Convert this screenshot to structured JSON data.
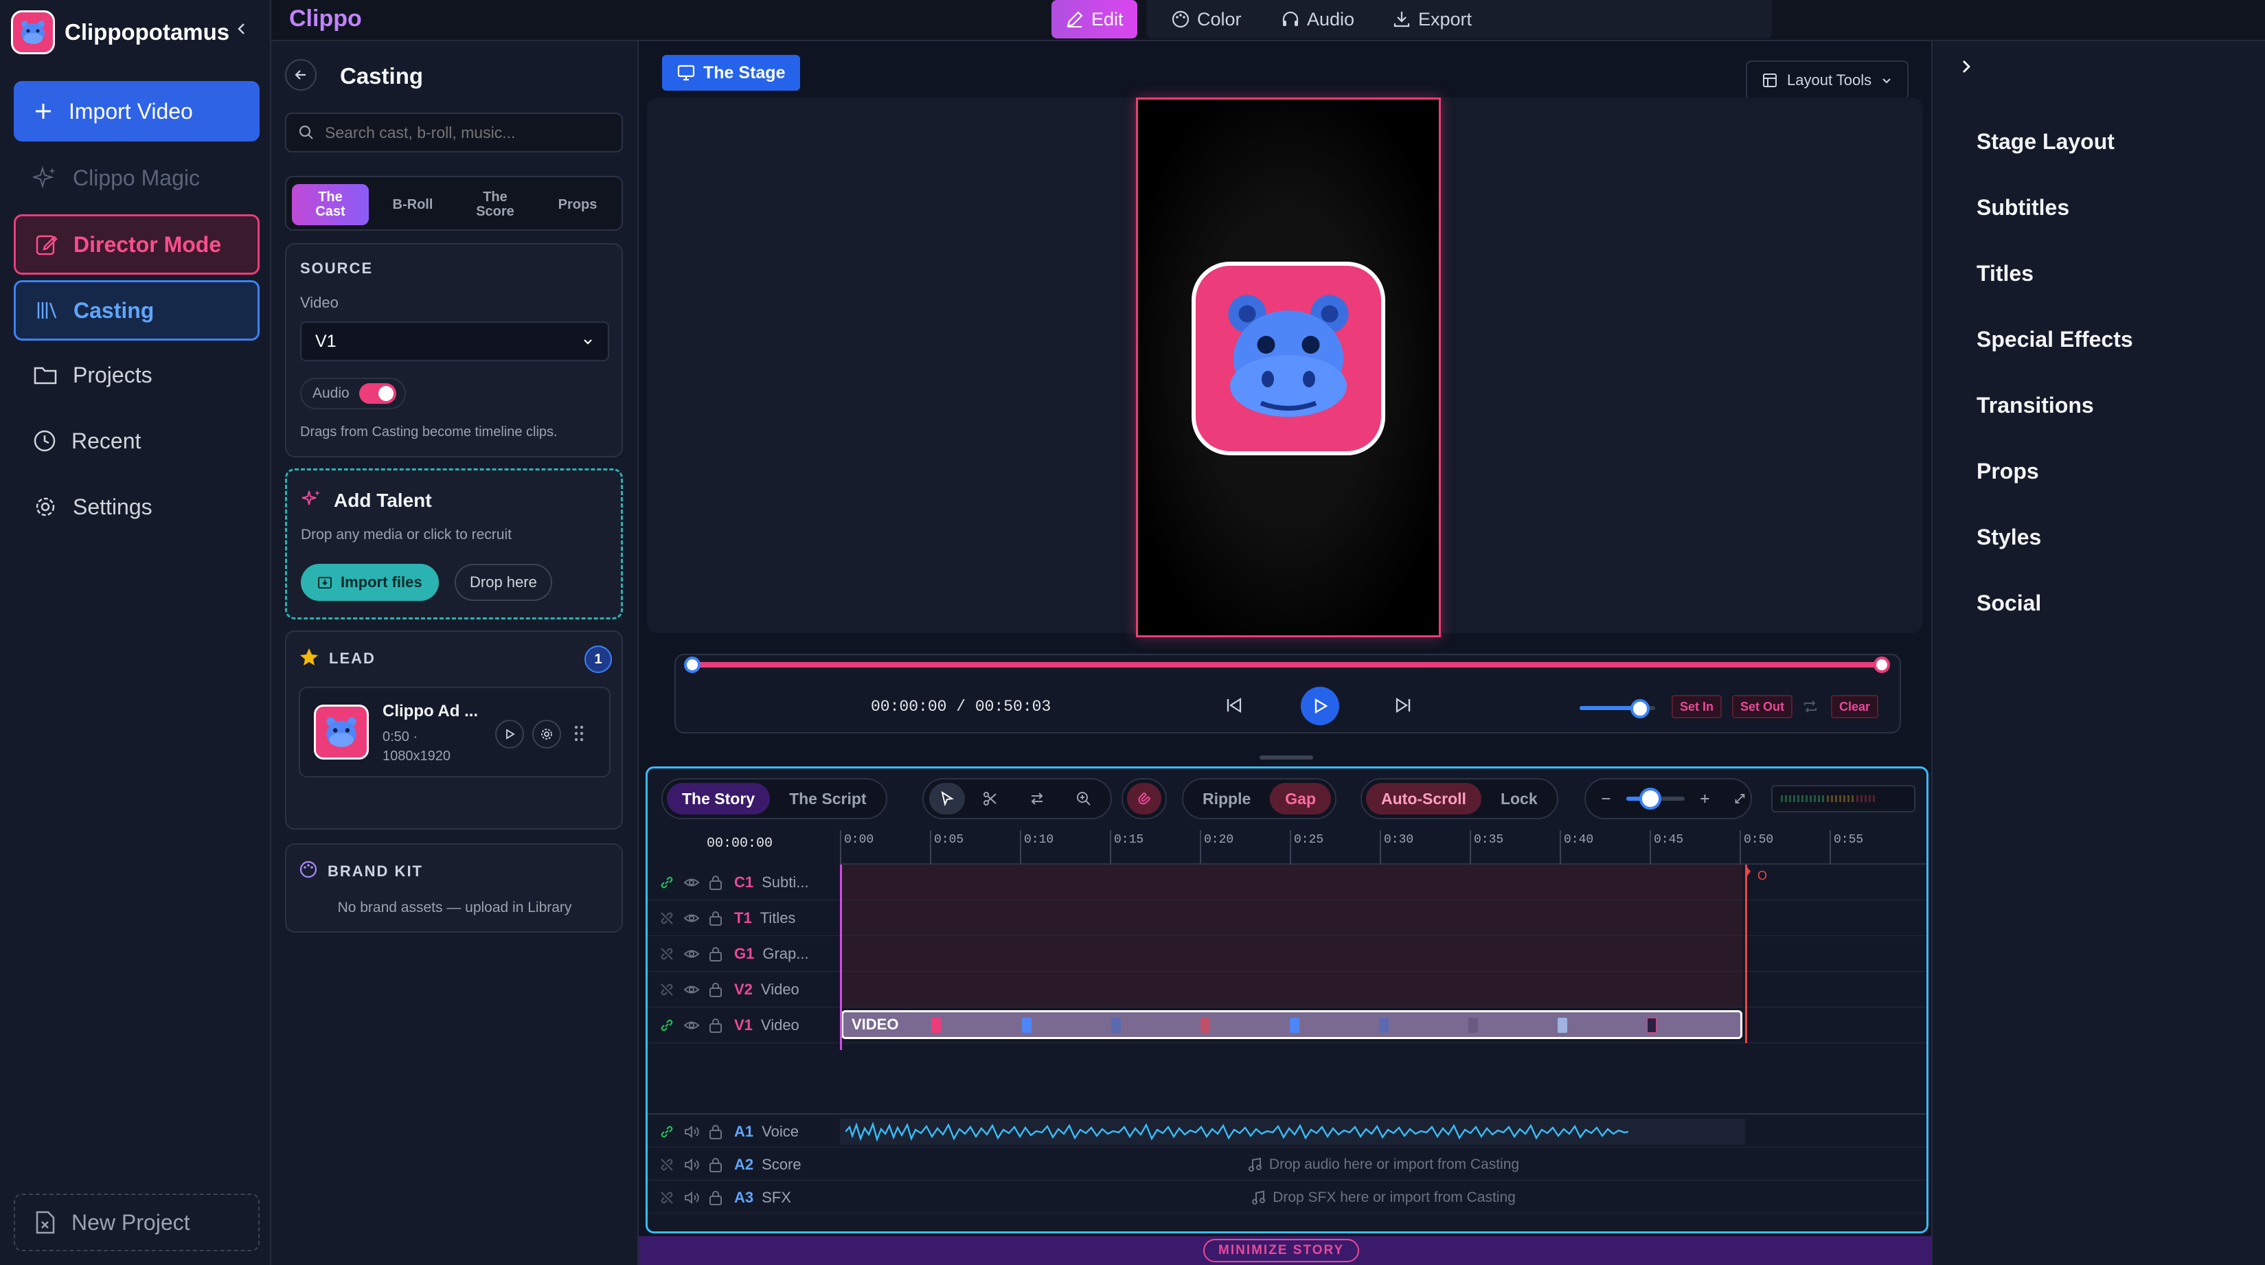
{
  "sidebar": {
    "brand": "Clippopotamus",
    "nav": [
      {
        "label": "Import Video"
      },
      {
        "label": "Clippo Magic"
      },
      {
        "label": "Director Mode"
      },
      {
        "label": "Casting"
      },
      {
        "label": "Projects"
      },
      {
        "label": "Recent"
      },
      {
        "label": "Settings"
      }
    ],
    "new_project": "New Project"
  },
  "topbar": {
    "app_title": "Clippo",
    "modes": [
      {
        "label": "Edit",
        "active": true
      },
      {
        "label": "Color"
      },
      {
        "label": "Audio"
      },
      {
        "label": "Export"
      }
    ]
  },
  "casting": {
    "title": "Casting",
    "search_placeholder": "Search cast, b-roll, music...",
    "tabs": [
      "The\nCast",
      "B-Roll",
      "The\nScore",
      "Props"
    ],
    "source": {
      "heading": "SOURCE",
      "video_label": "Video",
      "video_value": "V1",
      "audio_label": "Audio",
      "audio_on": true,
      "hint": "Drags from Casting become timeline clips."
    },
    "add_talent": {
      "title": "Add Talent",
      "subtitle": "Drop any media or click to recruit",
      "import_label": "Import files",
      "drop_label": "Drop here"
    },
    "lead": {
      "heading": "LEAD",
      "count": "1",
      "clip_title": "Clippo Ad ...",
      "clip_duration": "0:50 ·",
      "clip_res": "1080x1920"
    },
    "brand_kit": {
      "heading": "BRAND KIT",
      "empty": "No brand assets — upload in Library"
    }
  },
  "stage": {
    "tab_label": "The Stage",
    "layout_tools": "Layout Tools",
    "timecode": "00:00:00 / 00:50:03",
    "progress": 0.0,
    "volume": 0.8,
    "set_in": "Set In",
    "set_out": "Set Out",
    "clear": "Clear"
  },
  "right_panel": {
    "items": [
      "Stage Layout",
      "Subtitles",
      "Titles",
      "Special Effects",
      "Transitions",
      "Props",
      "Styles",
      "Social"
    ]
  },
  "timeline": {
    "view_tabs": [
      {
        "label": "The Story",
        "active": true
      },
      {
        "label": "The Script"
      }
    ],
    "edit_modes": [
      {
        "label": "Ripple"
      },
      {
        "label": "Gap",
        "active": true
      }
    ],
    "scroll_modes": [
      {
        "label": "Auto-Scroll",
        "active": true
      },
      {
        "label": "Lock"
      }
    ],
    "zoom": 0.35,
    "time_origin": "00:00:00",
    "ticks": [
      "0:00",
      "0:05",
      "0:10",
      "0:15",
      "0:20",
      "0:25",
      "0:30",
      "0:35",
      "0:40",
      "0:45",
      "0:50",
      "0:55"
    ],
    "end_marker": "O",
    "tracks": [
      {
        "id": "C1",
        "name": "Subti...",
        "kind": "video"
      },
      {
        "id": "T1",
        "name": "Titles",
        "kind": "video"
      },
      {
        "id": "G1",
        "name": "Grap...",
        "kind": "video"
      },
      {
        "id": "V2",
        "name": "Video",
        "kind": "video"
      },
      {
        "id": "V1",
        "name": "Video",
        "kind": "video",
        "clip_label": "VIDEO"
      }
    ],
    "audio_tracks": [
      {
        "id": "A1",
        "name": "Voice"
      },
      {
        "id": "A2",
        "name": "Score",
        "placeholder": "Drop audio here or import from Casting"
      },
      {
        "id": "A3",
        "name": "SFX",
        "placeholder": "Drop SFX here or import from Casting"
      }
    ],
    "minimize_label": "MINIMIZE STORY"
  },
  "colors": {
    "accent_pink": "#ec3c7a",
    "accent_blue": "#2563eb",
    "accent_teal": "#2ab3b1",
    "timeline_border": "#38bdf8"
  }
}
